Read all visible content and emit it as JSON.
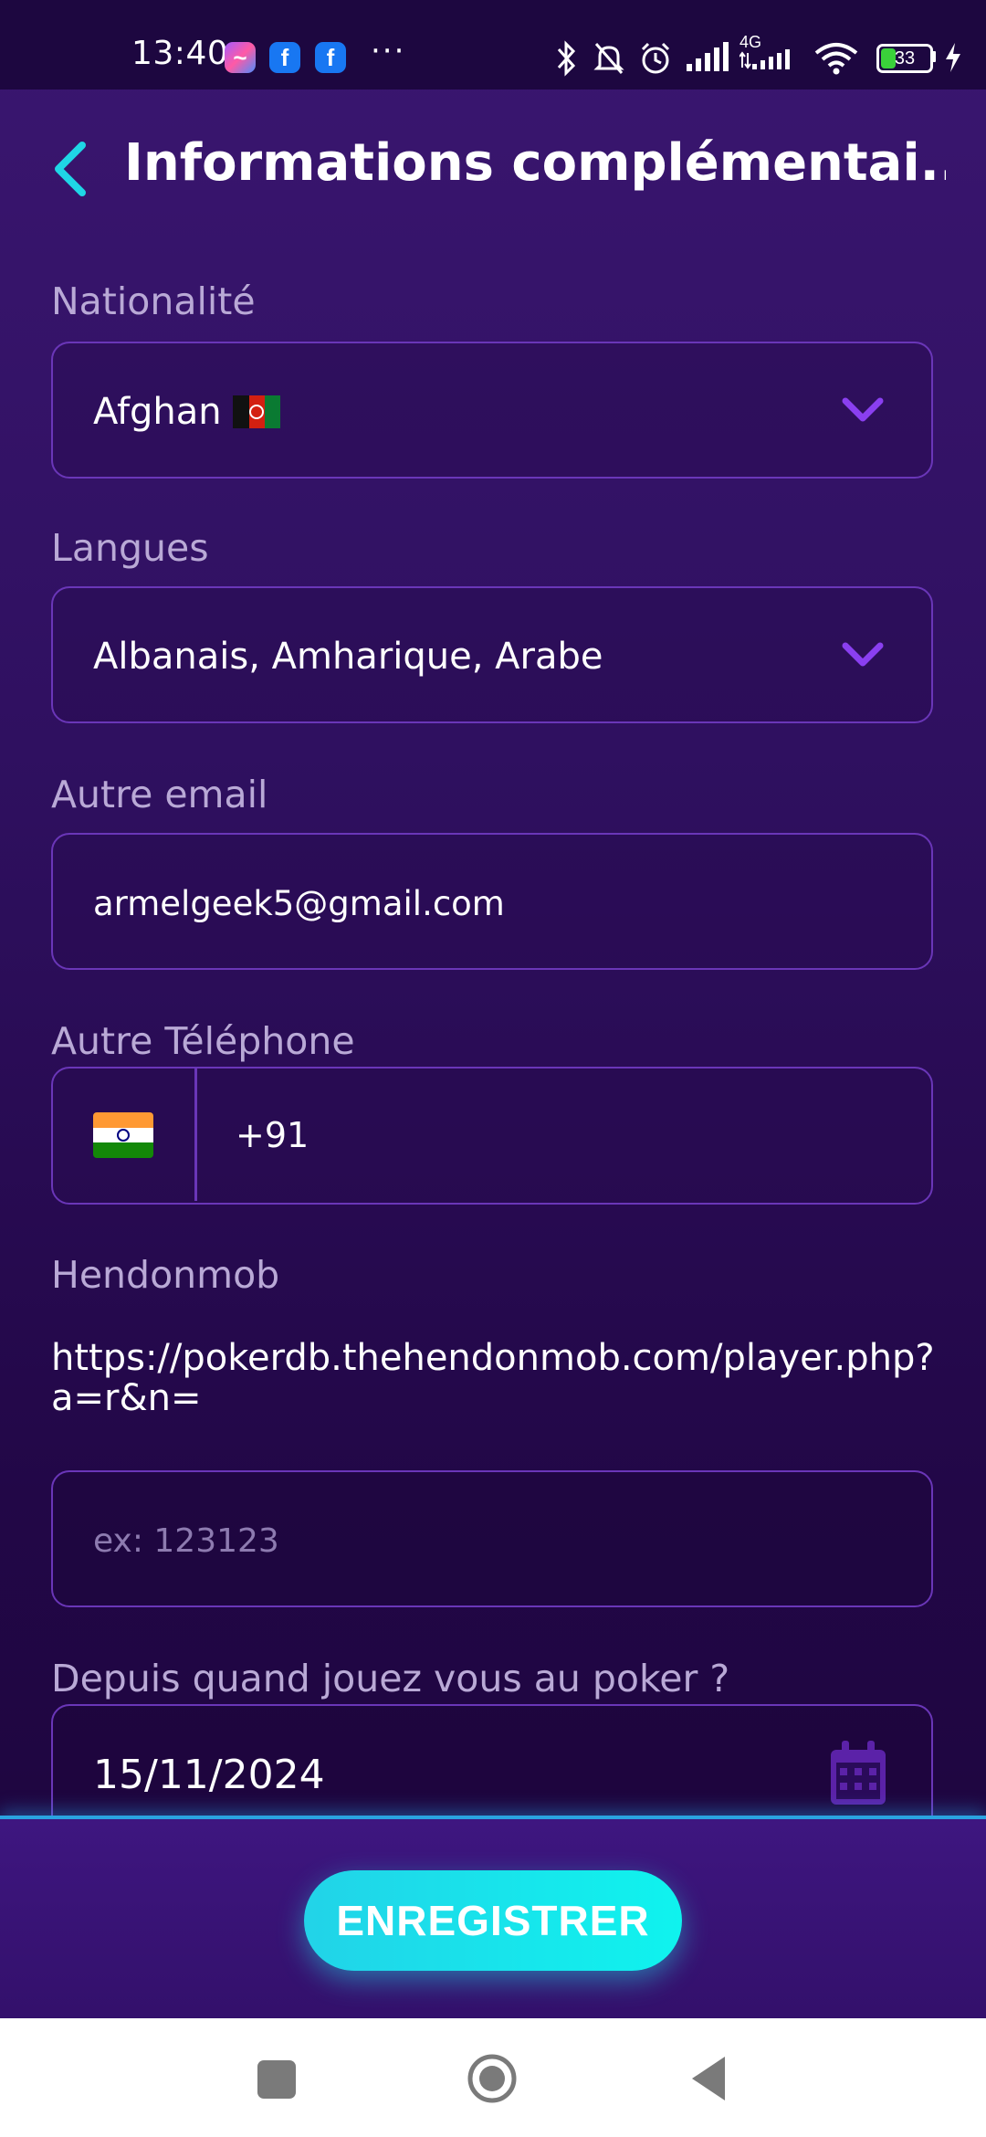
{
  "status_bar": {
    "time": "13:40",
    "apps": [
      "messenger-icon",
      "facebook-icon",
      "facebook-icon"
    ],
    "more": "···",
    "network": "4G",
    "battery": "33",
    "battery_level": 0.33,
    "battery_color": "#3ad13a"
  },
  "header": {
    "title": "Informations complémentai...",
    "accent": "#1fd6e6"
  },
  "form": {
    "nationality": {
      "label": "Nationalité",
      "value": "Afghan"
    },
    "languages": {
      "label": "Langues",
      "value": "Albanais, Amharique, Arabe"
    },
    "other_email": {
      "label": "Autre email",
      "value": "armelgeek5@gmail.com"
    },
    "other_phone": {
      "label": "Autre Téléphone",
      "code": "+91"
    },
    "hendonmob": {
      "label": "Hendonmob",
      "url": "https://pokerdb.thehendonmob.com/player.php?a=r&n=",
      "placeholder": "ex: 123123"
    },
    "poker_since": {
      "label": "Depuis quand jouez vous au poker ?",
      "value": "15/11/2024"
    }
  },
  "actions": {
    "save_label": "ENREGISTRER"
  },
  "colors": {
    "background": "#2a0b5a",
    "field_border": "#6a36b8",
    "label": "#b9a9d6",
    "chevron": "#8a3ff0",
    "button": "#16e6ec"
  }
}
